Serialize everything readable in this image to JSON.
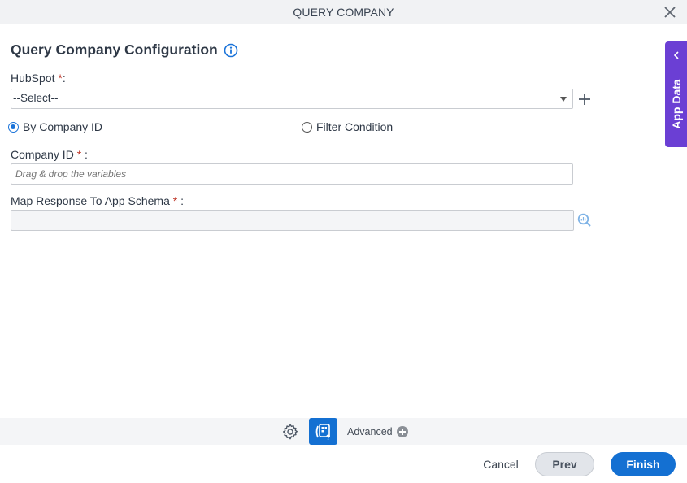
{
  "window": {
    "title": "QUERY COMPANY"
  },
  "form": {
    "heading": "Query Company Configuration",
    "hubspot": {
      "label": "HubSpot ",
      "required_mark": "*",
      "suffix": ":",
      "selected": "--Select--"
    },
    "query_mode": {
      "options": [
        {
          "label": "By Company ID",
          "checked": true
        },
        {
          "label": "Filter Condition",
          "checked": false
        }
      ]
    },
    "company_id": {
      "label": "Company ID ",
      "required_mark": "*",
      "suffix": " :",
      "placeholder": "Drag & drop the variables",
      "value": ""
    },
    "map_response": {
      "label": "Map Response To App Schema ",
      "required_mark": "*",
      "suffix": " :",
      "value": ""
    }
  },
  "side_panel": {
    "label": "App Data"
  },
  "toolbar": {
    "advanced_label": "Advanced"
  },
  "footer": {
    "cancel_label": "Cancel",
    "prev_label": "Prev",
    "finish_label": "Finish"
  },
  "colors": {
    "accent_blue": "#1470d2",
    "app_data_purple": "#6b3fd4",
    "required_red": "#c0392b"
  }
}
